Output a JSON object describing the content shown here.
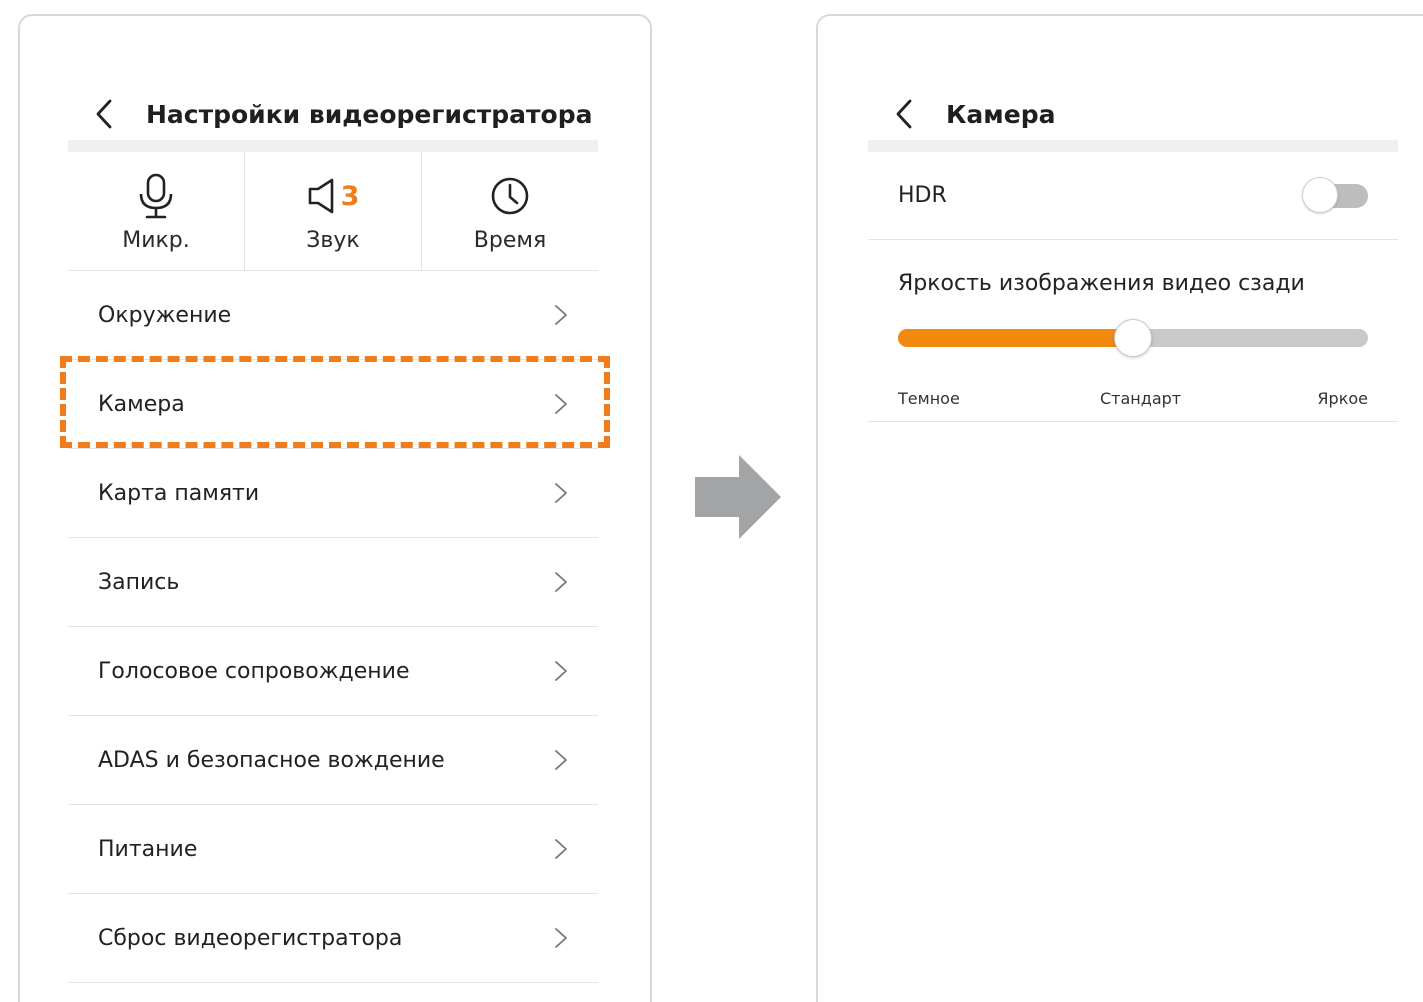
{
  "left_screen": {
    "title": "Настройки видеорегистратора",
    "back_icon": "chevron-left-icon",
    "quick_tiles": [
      {
        "label": "Микр.",
        "icon": "microphone-icon"
      },
      {
        "label": "Звук",
        "icon": "speaker-icon",
        "badge": "3"
      },
      {
        "label": "Время",
        "icon": "clock-icon"
      }
    ],
    "menu": [
      {
        "label": "Окружение"
      },
      {
        "label": "Камера",
        "highlighted": true
      },
      {
        "label": "Карта памяти"
      },
      {
        "label": "Запись"
      },
      {
        "label": "Голосовое сопровождение"
      },
      {
        "label": "ADAS и безопасное вождение"
      },
      {
        "label": "Питание"
      },
      {
        "label": "Сброс видеорегистратора"
      }
    ]
  },
  "right_screen": {
    "title": "Камера",
    "back_icon": "chevron-left-icon",
    "hdr": {
      "label": "HDR",
      "enabled": false
    },
    "brightness": {
      "title": "Яркость изображения видео сзади",
      "value_fraction": 0.5,
      "labels": {
        "min": "Темное",
        "mid": "Стандарт",
        "max": "Яркое"
      }
    }
  },
  "colors": {
    "accent": "#f07c1c",
    "slider_fill": "#f28a0f",
    "arrow": "#a3a4a6",
    "divider": "#e4e4e4"
  }
}
